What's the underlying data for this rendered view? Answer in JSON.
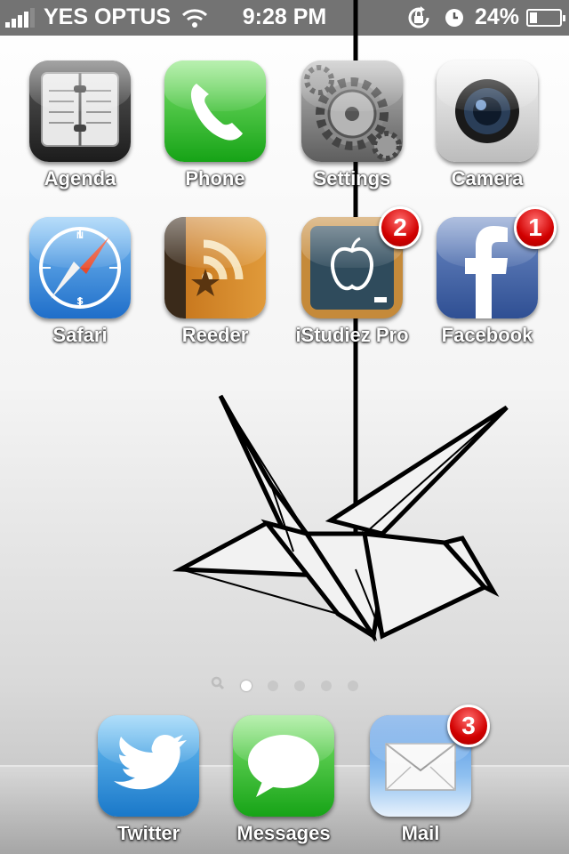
{
  "status_bar": {
    "carrier": "YES OPTUS",
    "time": "9:28 PM",
    "battery": "24%",
    "battery_level": 0.24,
    "signal_bars": 4,
    "icons": [
      "signal-bars-icon",
      "wifi-icon",
      "orientation-lock-icon",
      "alarm-clock-icon",
      "battery-icon"
    ]
  },
  "apps": [
    {
      "label": "Agenda",
      "icon": "agenda-icon"
    },
    {
      "label": "Phone",
      "icon": "phone-icon"
    },
    {
      "label": "Settings",
      "icon": "settings-gears-icon"
    },
    {
      "label": "Camera",
      "icon": "camera-lens-icon"
    },
    {
      "label": "Safari",
      "icon": "compass-icon"
    },
    {
      "label": "Reeder",
      "icon": "rss-star-icon"
    },
    {
      "label": "iStudiez Pro",
      "icon": "apple-chalkboard-icon",
      "badge": "2"
    },
    {
      "label": "Facebook",
      "icon": "facebook-f-icon",
      "badge": "1"
    }
  ],
  "page_dots": {
    "count": 5,
    "active_index": 0,
    "spotlight_icon": "search-icon"
  },
  "dock": [
    {
      "label": "Twitter",
      "icon": "twitter-bird-icon"
    },
    {
      "label": "Messages",
      "icon": "speech-bubble-icon"
    },
    {
      "label": "Mail",
      "icon": "envelope-icon",
      "badge": "3"
    }
  ],
  "wallpaper": {
    "subject": "origami-crane",
    "colors": {
      "top": "#ffffff",
      "bottom": "#bdbdbd",
      "line": "#000000"
    }
  },
  "colors": {
    "badge": "#d10000",
    "phone_green": "#2fb52f",
    "facebook_blue": "#3b5998",
    "safari_blue": "#2a86d8"
  }
}
